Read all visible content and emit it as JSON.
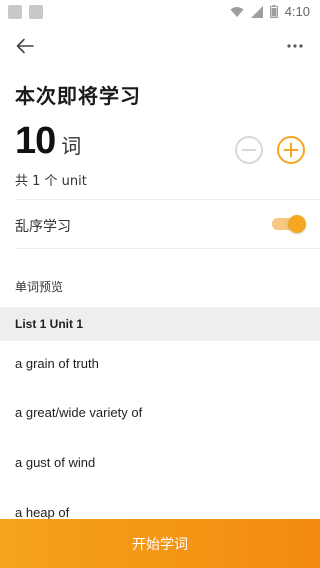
{
  "status_bar": {
    "time": "4:10"
  },
  "header": {
    "title": "本次即将学习"
  },
  "word_count": {
    "value": "10",
    "unit_label": "词",
    "total_units": "共 1 个 unit"
  },
  "shuffle": {
    "label": "乱序学习",
    "enabled": true
  },
  "preview": {
    "label": "单词预览",
    "list_title": "List 1 Unit 1",
    "words": [
      "a grain of truth",
      "a great/wide variety of",
      "a gust of wind",
      "a heap of"
    ]
  },
  "start_button": {
    "label": "开始学词"
  },
  "colors": {
    "accent": "#f5a623",
    "accent_light": "#f6c77f",
    "disabled": "#d8d8d8"
  },
  "icons": {
    "back": "arrow-left-icon",
    "more": "more-horizontal-icon",
    "minus": "minus-circle-icon",
    "plus": "plus-circle-icon"
  }
}
